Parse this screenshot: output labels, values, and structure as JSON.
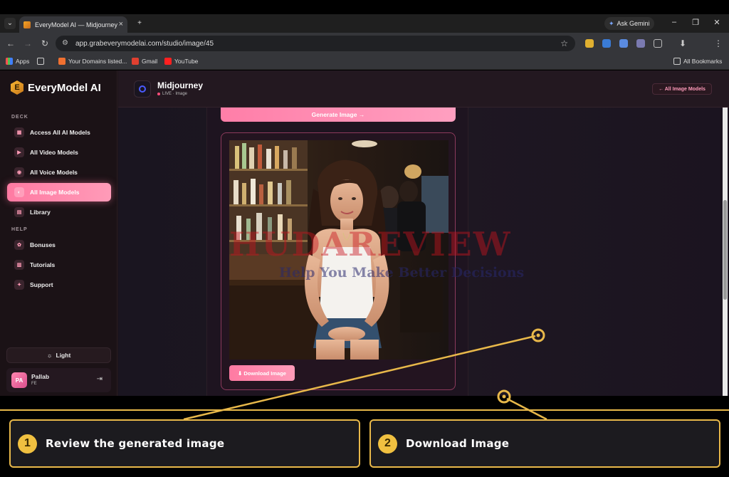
{
  "browser": {
    "tab_title": "EveryModel AI — Midjourney",
    "gemini_label": "Ask Gemini",
    "url": "app.grabeverymodelai.com/studio/image/45",
    "bookmarks": [
      "Apps",
      "Your Domains listed...",
      "Gmail",
      "YouTube"
    ],
    "all_bookmarks": "All Bookmarks"
  },
  "app": {
    "logo": "EveryModel AI",
    "sections": {
      "deck": "DECK",
      "help": "HELP"
    },
    "nav": [
      {
        "label": "Access All AI Models",
        "icon": "grid-icon"
      },
      {
        "label": "All Video Models",
        "icon": "play-icon"
      },
      {
        "label": "All Voice Models",
        "icon": "voice-icon"
      },
      {
        "label": "All Image Models",
        "icon": "image-icon",
        "active": true
      },
      {
        "label": "Library",
        "icon": "library-icon"
      },
      {
        "label": "Bonuses",
        "icon": "gift-icon"
      },
      {
        "label": "Tutorials",
        "icon": "tutorials-icon"
      },
      {
        "label": "Support",
        "icon": "support-icon"
      }
    ],
    "light_toggle": "Light",
    "user": {
      "initials": "PA",
      "name": "Pallab",
      "plan": "FE"
    },
    "header": {
      "title": "Midjourney",
      "status": "LIVE · Image",
      "back_button": "← All Image Models"
    },
    "generate_button": "Generate Image →",
    "download_button": "⬇ Download Image"
  },
  "watermark": {
    "brand": "HUDAREVIEW",
    "tagline": "Help You Make Better Decisions"
  },
  "tutorial": {
    "steps": [
      {
        "number": "1",
        "text": "Review the generated image"
      },
      {
        "number": "2",
        "text": "Download Image"
      }
    ],
    "accent_color": "#e8b84a"
  }
}
